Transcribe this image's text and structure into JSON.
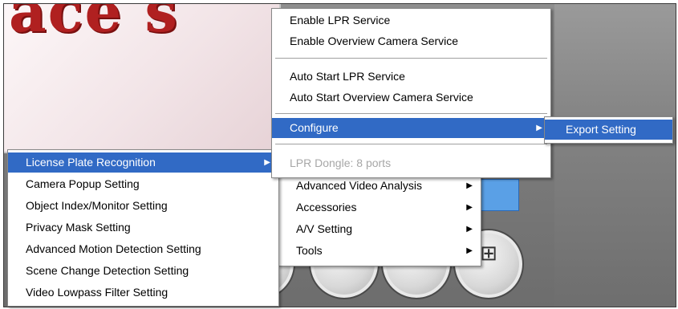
{
  "background": {
    "logo_text": "ace s",
    "accent_color": "#316ac5"
  },
  "context_menu_lpr": {
    "items": [
      {
        "label": "Enable LPR Service"
      },
      {
        "label": "Enable Overview Camera Service"
      },
      {
        "label": "Auto Start LPR Service"
      },
      {
        "label": "Auto Start Overview Camera Service"
      },
      {
        "label": "Configure",
        "submenu": true,
        "selected": true
      },
      {
        "label": "LPR Dongle: 8 ports",
        "disabled": true
      }
    ]
  },
  "submenu_configure": {
    "items": [
      {
        "label": "Export Setting",
        "selected": true
      }
    ]
  },
  "settings_menu": {
    "items": [
      {
        "label": "License Plate Recognition",
        "submenu": true,
        "selected": true
      },
      {
        "label": "Camera Popup Setting"
      },
      {
        "label": "Object Index/Monitor Setting"
      },
      {
        "label": "Privacy Mask Setting"
      },
      {
        "label": "Advanced Motion Detection Setting"
      },
      {
        "label": "Scene Change Detection Setting"
      },
      {
        "label": "Video Lowpass Filter Setting"
      }
    ]
  },
  "tools_menu": {
    "items": [
      {
        "label": "Advanced Video Analysis",
        "submenu": true
      },
      {
        "label": "Accessories",
        "submenu": true
      },
      {
        "label": "A/V Setting",
        "submenu": true
      },
      {
        "label": "Tools",
        "submenu": true
      }
    ]
  },
  "icons": {
    "submenu_arrow": "▶",
    "round_buttons": [
      "search-icon",
      "camera-icon",
      "network-icon"
    ]
  }
}
